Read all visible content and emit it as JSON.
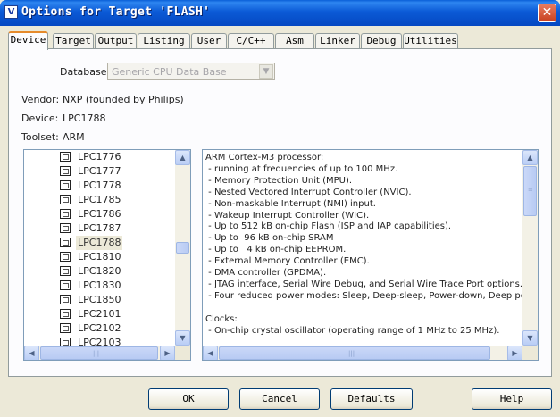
{
  "window": {
    "title": "Options for Target 'FLASH'",
    "icon_text": "V",
    "close_glyph": "✕"
  },
  "tabs": [
    {
      "label": "Device",
      "active": true
    },
    {
      "label": "Target"
    },
    {
      "label": "Output"
    },
    {
      "label": "Listing"
    },
    {
      "label": "User"
    },
    {
      "label": "C/C++"
    },
    {
      "label": "Asm"
    },
    {
      "label": "Linker"
    },
    {
      "label": "Debug"
    },
    {
      "label": "Utilities"
    }
  ],
  "database": {
    "label": "Database:",
    "value": "Generic CPU Data Base"
  },
  "info": {
    "vendor_label": "Vendor:",
    "vendor_value": "NXP (founded by Philips)",
    "device_label": "Device:",
    "device_value": "LPC1788",
    "toolset_label": "Toolset:",
    "toolset_value": "ARM"
  },
  "device_list": {
    "items": [
      "LPC1776",
      "LPC1777",
      "LPC1778",
      "LPC1785",
      "LPC1786",
      "LPC1787",
      "LPC1788",
      "LPC1810",
      "LPC1820",
      "LPC1830",
      "LPC1850",
      "LPC2101",
      "LPC2102",
      "LPC2103"
    ],
    "selected": "LPC1788"
  },
  "description": {
    "lines": [
      "ARM Cortex-M3 processor:",
      " - running at frequencies of up to 100 MHz.",
      " - Memory Protection Unit (MPU).",
      " - Nested Vectored Interrupt Controller (NVIC).",
      " - Non-maskable Interrupt (NMI) input.",
      " - Wakeup Interrupt Controller (WIC).",
      " - Up to 512 kB on-chip Flash (ISP and IAP capabilities).",
      " - Up to  96 kB on-chip SRAM",
      " - Up to   4 kB on-chip EEPROM.",
      " - External Memory Controller (EMC).",
      " - DMA controller (GPDMA).",
      " - JTAG interface, Serial Wire Debug, and Serial Wire Trace Port options.",
      " - Four reduced power modes: Sleep, Deep-sleep, Power-down, Deep powe",
      "",
      "Clocks:",
      " - On-chip crystal oscillator (operating range of 1 MHz to 25 MHz)."
    ]
  },
  "buttons": {
    "ok": "OK",
    "cancel": "Cancel",
    "defaults": "Defaults",
    "help": "Help"
  },
  "scroll_glyphs": {
    "up": "▲",
    "down": "▼",
    "left": "◀",
    "right": "▶",
    "grip_v": "≡",
    "grip_h": "|||"
  },
  "colors": {
    "titlebar": "#0b5ad6",
    "dialog_bg": "#ece9d8",
    "active_tab_accent": "#e68b2c"
  }
}
